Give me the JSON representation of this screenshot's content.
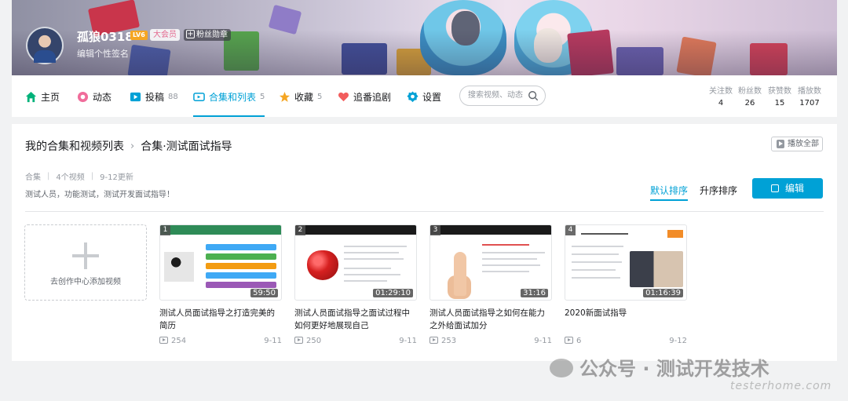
{
  "profile": {
    "username": "孤狼0318",
    "level": "LV6",
    "vip_badge": "大会员",
    "fan_badge": "粉丝勋章",
    "signature": "编辑个性签名"
  },
  "nav": {
    "items": [
      {
        "label": "主页",
        "count": null,
        "icon": "home-icon",
        "color": "#00b27a"
      },
      {
        "label": "动态",
        "count": null,
        "icon": "dynamic-icon",
        "color": "#f06d9b"
      },
      {
        "label": "投稿",
        "count": "88",
        "icon": "upload-icon",
        "color": "#00a1d6"
      },
      {
        "label": "合集和列表",
        "count": "5",
        "icon": "collection-icon",
        "color": "#00a1d6"
      },
      {
        "label": "收藏",
        "count": "5",
        "icon": "star-icon",
        "color": "#f5a623"
      },
      {
        "label": "追番追剧",
        "count": null,
        "icon": "heart-icon",
        "color": "#f25d5d"
      },
      {
        "label": "设置",
        "count": null,
        "icon": "gear-icon",
        "color": "#00a1d6"
      }
    ],
    "active": "合集和列表",
    "search_placeholder": "搜索视频、动态",
    "stats": [
      {
        "label": "关注数",
        "value": "4"
      },
      {
        "label": "粉丝数",
        "value": "26"
      },
      {
        "label": "获赞数",
        "value": "15"
      },
      {
        "label": "播放数",
        "value": "1707"
      }
    ]
  },
  "collection": {
    "breadcrumb_root": "我的合集和视频列表",
    "breadcrumb_current": "合集·测试面试指导",
    "play_all": "播放全部",
    "type": "合集",
    "video_count": "4个视频",
    "updated": "9-12更新",
    "description": "测试人员，功能测试，测试开发面试指导！",
    "sort_default": "默认排序",
    "sort_asc": "升序排序",
    "edit_label": "编辑",
    "add_video": "去创作中心添加视频"
  },
  "videos": [
    {
      "index": "1",
      "duration": "59:50",
      "title": "测试人员面试指导之打造完美的简历",
      "plays": "254",
      "date": "9-11"
    },
    {
      "index": "2",
      "duration": "01:29:10",
      "title": "测试人员面试指导之面试过程中如何更好地展现自己",
      "plays": "250",
      "date": "9-11"
    },
    {
      "index": "3",
      "duration": "31:16",
      "title": "测试人员面试指导之如何在能力之外给面试加分",
      "plays": "253",
      "date": "9-11"
    },
    {
      "index": "4",
      "duration": "01:16:39",
      "title": "2020新面试指导",
      "plays": "6",
      "date": "9-12"
    }
  ],
  "watermark": {
    "text": "公众号 · 测试开发技术",
    "site": "testerhome.com"
  }
}
